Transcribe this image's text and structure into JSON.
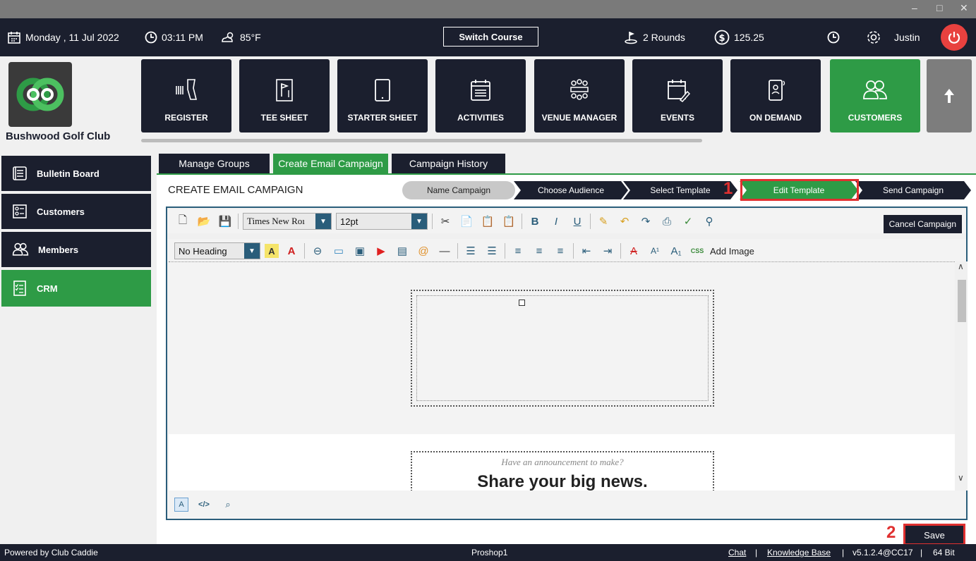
{
  "window": {
    "minimize": "–",
    "maximize": "□",
    "close": "✕"
  },
  "topbar": {
    "date": "Monday , 11 Jul 2022",
    "time": "03:11 PM",
    "weather": "85°F",
    "switch_course": "Switch Course",
    "rounds": "2 Rounds",
    "amount": "125.25",
    "user": "Justin"
  },
  "club": {
    "name": "Bushwood Golf Club"
  },
  "nav": [
    {
      "label": "REGISTER",
      "icon": "barcode-scanner-icon"
    },
    {
      "label": "TEE SHEET",
      "icon": "flag-sheet-icon"
    },
    {
      "label": "STARTER SHEET",
      "icon": "tablet-icon"
    },
    {
      "label": "ACTIVITIES",
      "icon": "calendar-list-icon"
    },
    {
      "label": "VENUE MANAGER",
      "icon": "meeting-icon"
    },
    {
      "label": "EVENTS",
      "icon": "calendar-edit-icon"
    },
    {
      "label": "ON DEMAND",
      "icon": "phone-icon"
    },
    {
      "label": "CUSTOMERS",
      "icon": "users-icon"
    }
  ],
  "sidebar": [
    {
      "label": "Bulletin Board"
    },
    {
      "label": "Customers"
    },
    {
      "label": "Members"
    },
    {
      "label": "CRM"
    }
  ],
  "tabs": [
    {
      "label": "Manage Groups"
    },
    {
      "label": "Create Email Campaign"
    },
    {
      "label": "Campaign History"
    }
  ],
  "campaign": {
    "title": "CREATE EMAIL CAMPAIGN",
    "steps": [
      {
        "label": "Name Campaign"
      },
      {
        "label": "Choose Audience"
      },
      {
        "label": "Select Template"
      },
      {
        "label": "Edit Template"
      },
      {
        "label": "Send Campaign"
      }
    ],
    "cancel": "Cancel Campaign",
    "save": "Save"
  },
  "annotations": {
    "one": "1",
    "two": "2"
  },
  "editor": {
    "font": "Times New Roı",
    "size": "12pt",
    "heading": "No Heading",
    "add_image": "Add Image",
    "announcement": "Have an announcement to make?",
    "headline": "Share your big news."
  },
  "status": {
    "powered": "Powered by Club Caddie",
    "station": "Proshop1",
    "chat": "Chat",
    "sep1": "|",
    "kb": "Knowledge Base",
    "sep2": "|",
    "version": "v5.1.2.4@CC17",
    "sep3": "|",
    "bits": "64 Bit"
  },
  "colors": {
    "accent_green": "#2e9b46",
    "navy": "#1b1f2e",
    "highlight": "#e03030"
  }
}
